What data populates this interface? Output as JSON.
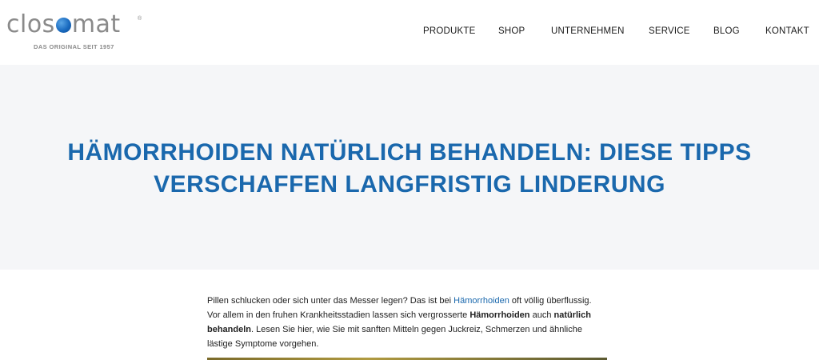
{
  "logo": {
    "word_before": "clos",
    "word_after": "mat",
    "registered": "®",
    "tagline": "DAS ORIGINAL SEIT 1957"
  },
  "nav": {
    "items": [
      {
        "label": "PRODUKTE"
      },
      {
        "label": "SHOP"
      },
      {
        "label": "UNTERNEHMEN"
      },
      {
        "label": "SERVICE"
      },
      {
        "label": "BLOG"
      },
      {
        "label": "KONTAKT"
      }
    ]
  },
  "hero": {
    "title_line1": "HÄMORRHOIDEN NATÜRLICH BEHANDELN: DIESE TIPPS",
    "title_line2": "VERSCHAFFEN LANGFRISTIG LINDERUNG"
  },
  "article": {
    "p1_a": "Pillen schlucken oder sich unter das Messer legen? Das ist bei ",
    "p1_link": "Hämorrhoiden",
    "p1_b": " oft völlig überflussig.",
    "p1_c": "Vor allem in den fruhen Krankheitsstadien lassen sich vergrosserte ",
    "p1_bold1": "Hämorrhoiden",
    "p1_d": " auch ",
    "p1_bold2": "natürlich",
    "p1_bold3": "behandeln",
    "p1_e": ". Lesen Sie hier, wie Sie mit sanften Mitteln gegen Juckreiz, Schmerzen und ähnliche",
    "p1_f": "lästige Symptome vorgehen."
  },
  "colors": {
    "accent": "#1a68ad",
    "hero_bg": "#f5f6f8",
    "logo_gray": "#8a8a8a"
  }
}
